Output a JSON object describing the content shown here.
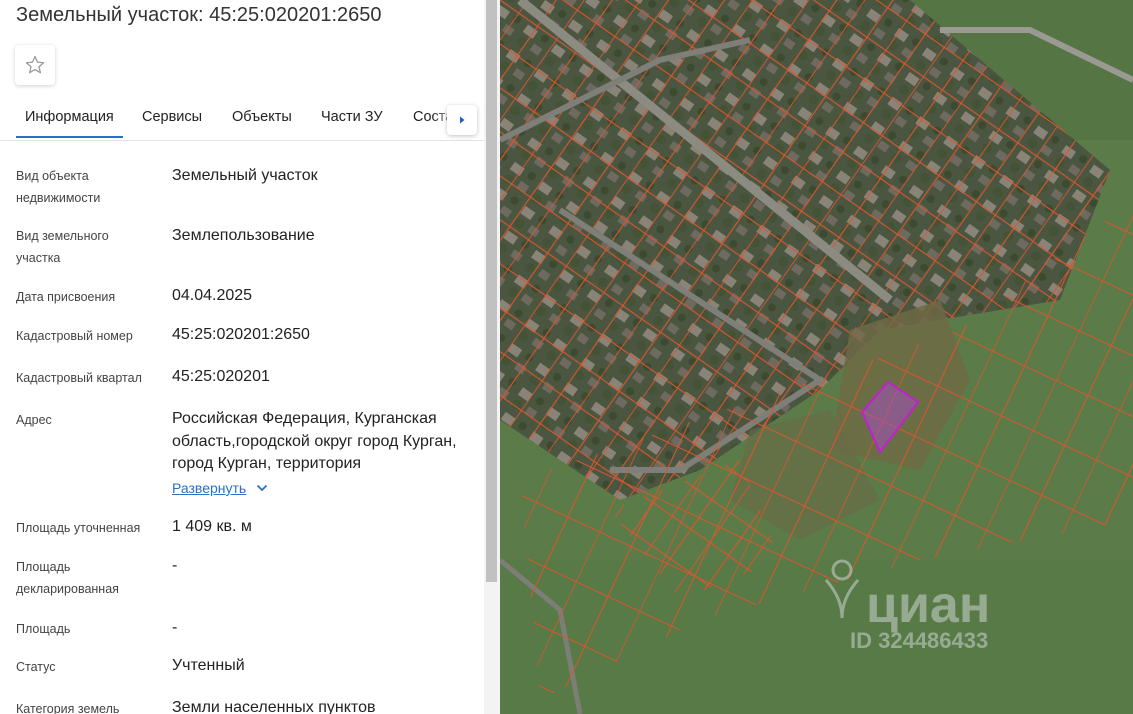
{
  "header": {
    "title": "Земельный участок: 45:25:020201:2650"
  },
  "tabs": [
    "Информация",
    "Сервисы",
    "Объекты",
    "Части ЗУ",
    "Состав ЕЗ"
  ],
  "fields": [
    {
      "label": "Вид объекта недвижимости",
      "value": "Земельный участок"
    },
    {
      "label": "Вид земельного участка",
      "value": "Землепользование"
    },
    {
      "label": "Дата присвоения",
      "value": "04.04.2025"
    },
    {
      "label": "Кадастровый номер",
      "value": "45:25:020201:2650"
    },
    {
      "label": "Кадастровый квартал",
      "value": "45:25:020201"
    },
    {
      "label": "Адрес",
      "value": "Российская Федерация, Курганская область,городской округ город Курган, город Курган, территория"
    },
    {
      "label": "Площадь уточненная",
      "value": "1 409 кв. м"
    },
    {
      "label": "Площадь декларированная",
      "value": "-"
    },
    {
      "label": "Площадь",
      "value": "-"
    },
    {
      "label": "Статус",
      "value": "Учтенный"
    },
    {
      "label": "Категория земель",
      "value": "Земли населенных пунктов"
    }
  ],
  "address_expand": "Развернуть",
  "map": {
    "watermark_brand": "циан",
    "watermark_id": "ID 324486433",
    "colors": {
      "parcel_border": "#d9562f",
      "selected_parcel": "#c21fd1",
      "vegetation": "#5d7e4a",
      "road": "#8b8b82"
    }
  },
  "icons": [
    "star-icon",
    "chevron-right-icon",
    "chevron-down-icon",
    "location-pin-icon"
  ]
}
